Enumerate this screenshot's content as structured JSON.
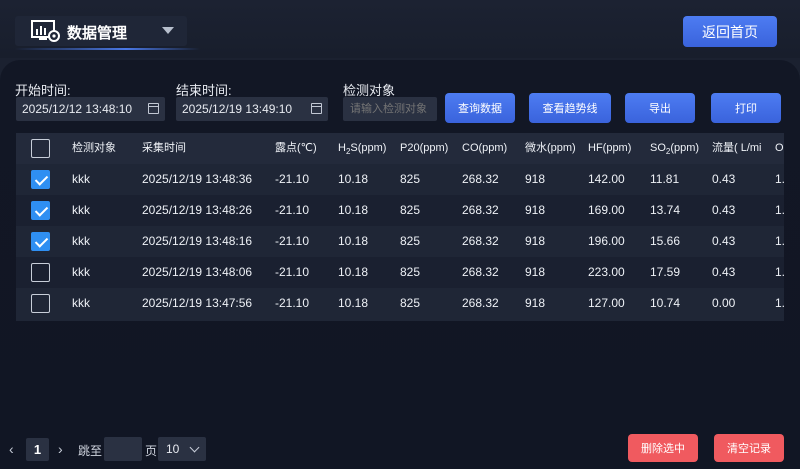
{
  "header": {
    "module_title": "数据管理",
    "home_button": "返回首页"
  },
  "filters": {
    "start_label": "开始时间:",
    "start_value": "2025/12/12 13:48:10",
    "end_label": "结束时间:",
    "end_value": "2025/12/19 13:49:10",
    "object_label": "检测对象",
    "object_placeholder": "请输入检测对象"
  },
  "toolbar": {
    "query": "查询数据",
    "trend": "查看趋势线",
    "export": "导出",
    "print": "打印"
  },
  "table": {
    "columns": [
      {
        "key": "object",
        "label": "检测对象"
      },
      {
        "key": "time",
        "label": "采集时间"
      },
      {
        "key": "dew",
        "label": "露点(℃)"
      },
      {
        "key": "h2s",
        "label_pre": "H",
        "label_sub": "2",
        "label_post": "S(ppm)"
      },
      {
        "key": "p20",
        "label": "P20(ppm)"
      },
      {
        "key": "co",
        "label": "CO(ppm)"
      },
      {
        "key": "water",
        "label": "微水(ppm)"
      },
      {
        "key": "hf",
        "label": "HF(ppm)"
      },
      {
        "key": "so2",
        "label_pre": "SO",
        "label_sub": "2",
        "label_post": "(ppm)"
      },
      {
        "key": "flow",
        "label": "流量( L/mi"
      },
      {
        "key": "extra",
        "label": "O"
      }
    ],
    "rows": [
      {
        "checked": true,
        "object": "kkk",
        "time": "2025/12/19 13:48:36",
        "dew": "-21.10",
        "h2s": "10.18",
        "p20": "825",
        "co": "268.32",
        "water": "918",
        "hf": "142.00",
        "so2": "11.81",
        "flow": "0.43",
        "extra": "1."
      },
      {
        "checked": true,
        "object": "kkk",
        "time": "2025/12/19 13:48:26",
        "dew": "-21.10",
        "h2s": "10.18",
        "p20": "825",
        "co": "268.32",
        "water": "918",
        "hf": "169.00",
        "so2": "13.74",
        "flow": "0.43",
        "extra": "1."
      },
      {
        "checked": true,
        "object": "kkk",
        "time": "2025/12/19 13:48:16",
        "dew": "-21.10",
        "h2s": "10.18",
        "p20": "825",
        "co": "268.32",
        "water": "918",
        "hf": "196.00",
        "so2": "15.66",
        "flow": "0.43",
        "extra": "1."
      },
      {
        "checked": false,
        "object": "kkk",
        "time": "2025/12/19 13:48:06",
        "dew": "-21.10",
        "h2s": "10.18",
        "p20": "825",
        "co": "268.32",
        "water": "918",
        "hf": "223.00",
        "so2": "17.59",
        "flow": "0.43",
        "extra": "1."
      },
      {
        "checked": false,
        "object": "kkk",
        "time": "2025/12/19 13:47:56",
        "dew": "-21.10",
        "h2s": "10.18",
        "p20": "825",
        "co": "268.32",
        "water": "918",
        "hf": "127.00",
        "so2": "10.74",
        "flow": "0.00",
        "extra": "1."
      }
    ]
  },
  "pagination": {
    "prev_icon": "‹",
    "current_page": "1",
    "next_icon": "›",
    "goto_label": "跳至",
    "page_suffix": "页",
    "page_size": "10"
  },
  "actions": {
    "delete_selected": "删除选中",
    "clear_records": "清空记录"
  },
  "colors": {
    "accent": "#3f6ce6",
    "danger": "#f05a5f",
    "checkbox": "#2f8ff2"
  },
  "icons": {
    "module": "dashboard-gear-icon",
    "calendar": "calendar-icon",
    "caret": "chevron-down-icon"
  }
}
